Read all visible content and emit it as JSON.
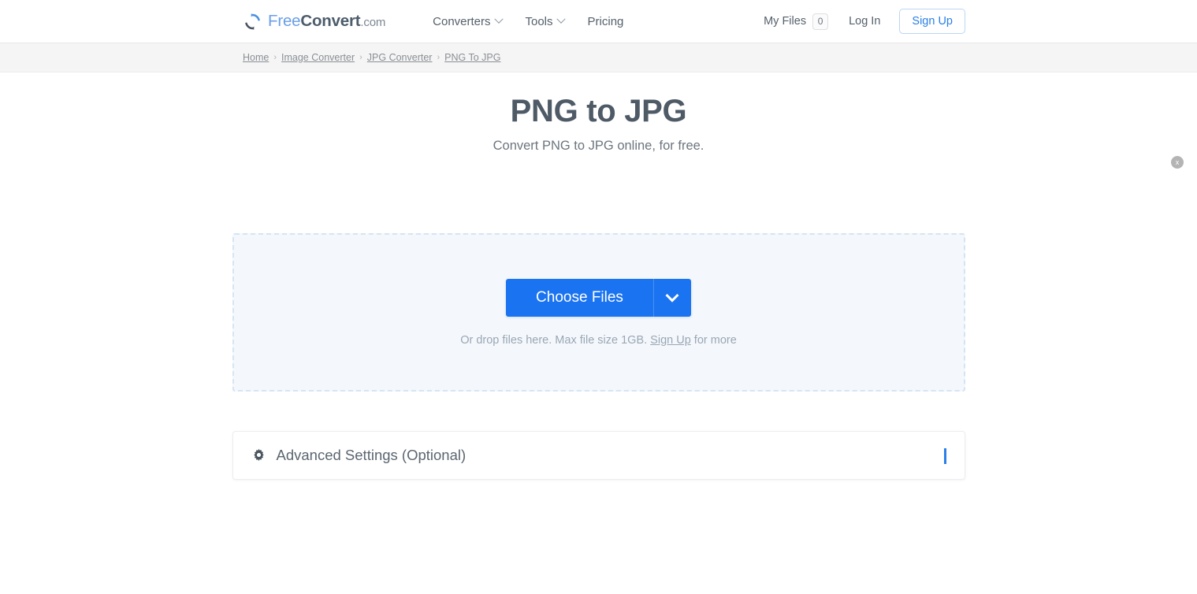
{
  "header": {
    "logo": {
      "icon": "convert-refresh-icon",
      "free": "Free",
      "convert": "Convert",
      "com": ".com"
    },
    "nav": [
      {
        "label": "Converters",
        "has_caret": true,
        "icon": "chevron-down-icon"
      },
      {
        "label": "Tools",
        "has_caret": true,
        "icon": "chevron-down-icon"
      },
      {
        "label": "Pricing",
        "has_caret": false,
        "icon": ""
      }
    ],
    "my_files_label": "My Files",
    "my_files_count": "0",
    "login_label": "Log In",
    "signup_label": "Sign Up"
  },
  "breadcrumb": {
    "separator": "›",
    "items": [
      {
        "label": "Home"
      },
      {
        "label": "Image Converter"
      },
      {
        "label": "JPG Converter"
      },
      {
        "label": "PNG To JPG"
      }
    ]
  },
  "main": {
    "close_label": "x",
    "title": "PNG to JPG",
    "subtitle": "Convert PNG to JPG online, for free.",
    "dropzone": {
      "choose_files_label": "Choose Files",
      "caret_icon": "chevron-down-icon",
      "hint_prefix": "Or drop files here. Max file size 1GB. ",
      "hint_link": "Sign Up",
      "hint_suffix": " for more"
    },
    "advanced": {
      "icon": "gear-icon",
      "label": "Advanced Settings (Optional)",
      "caret_icon": "chevron-down-icon"
    }
  },
  "colors": {
    "primary_blue": "#1a73f0",
    "link_blue": "#2b7fe8",
    "logo_blue": "#6a9fe8",
    "title_slate": "#4e5a66",
    "dropzone_bg": "#f4f8fc",
    "dropzone_border": "#d5e4f4",
    "crumb_bar_bg": "#f5f5f5"
  }
}
